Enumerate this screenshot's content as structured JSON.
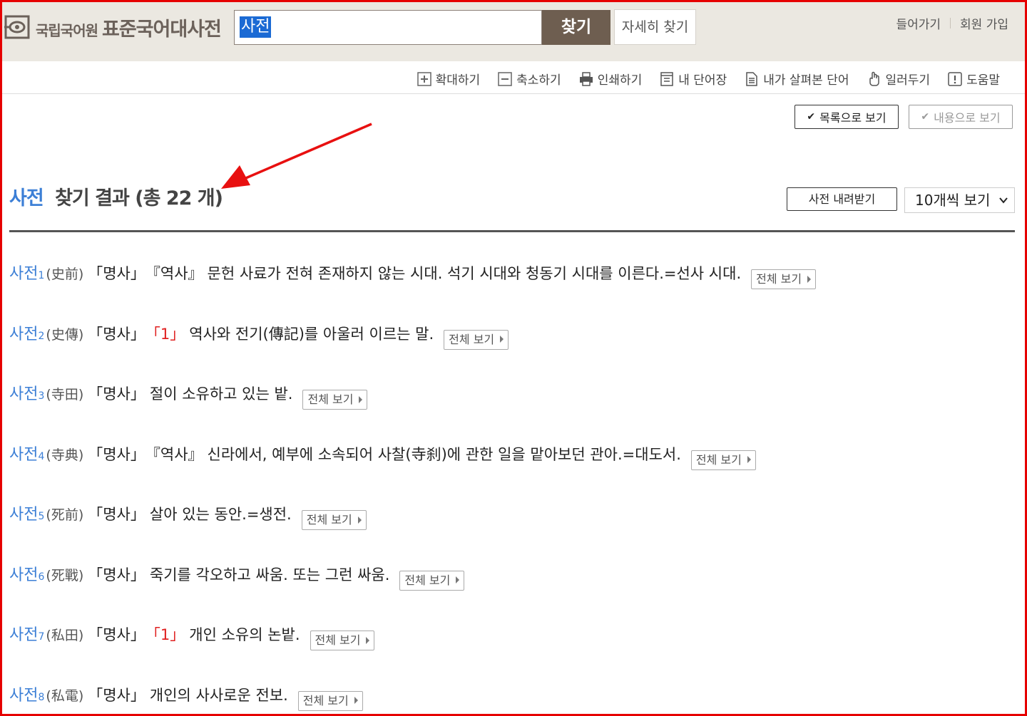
{
  "header": {
    "logo_org": "국립국어원",
    "logo_title": "표준국어대사전",
    "search_value": "사전",
    "search_button": "찾기",
    "detail_search_button": "자세히 찾기",
    "login_link": "들어가기",
    "signup_link": "회원 가입"
  },
  "toolbar": {
    "zoom_in": "확대하기",
    "zoom_out": "축소하기",
    "print": "인쇄하기",
    "my_words": "내 단어장",
    "viewed_words": "내가 살펴본 단어",
    "notice": "일러두기",
    "help": "도움말"
  },
  "view": {
    "list_view": "목록으로 보기",
    "content_view": "내용으로 보기"
  },
  "results": {
    "query": "사전",
    "label": "찾기 결과 (총 22 개)",
    "download_button": "사전 내려받기",
    "per_page": "10개씩 보기"
  },
  "entries": [
    {
      "word": "사전",
      "num": "1",
      "hanja": "(史前)",
      "pos": "「명사」",
      "field": "『역사』",
      "sense": "",
      "def": "문헌 사료가 전혀 존재하지 않는 시대. 석기 시대와 청동기 시대를 이른다.=선사 시대.",
      "more": "전체 보기"
    },
    {
      "word": "사전",
      "num": "2",
      "hanja": "(史傳)",
      "pos": "「명사」",
      "field": "",
      "sense": "「1」",
      "def": "역사와 전기(傳記)를 아울러 이르는 말.",
      "more": "전체 보기"
    },
    {
      "word": "사전",
      "num": "3",
      "hanja": "(寺田)",
      "pos": "「명사」",
      "field": "",
      "sense": "",
      "def": "절이 소유하고 있는 밭.",
      "more": "전체 보기"
    },
    {
      "word": "사전",
      "num": "4",
      "hanja": "(寺典)",
      "pos": "「명사」",
      "field": "『역사』",
      "sense": "",
      "def": "신라에서, 예부에 소속되어 사찰(寺刹)에 관한 일을 맡아보던 관아.=대도서.",
      "more": "전체 보기"
    },
    {
      "word": "사전",
      "num": "5",
      "hanja": "(死前)",
      "pos": "「명사」",
      "field": "",
      "sense": "",
      "def": "살아 있는 동안.=생전.",
      "more": "전체 보기"
    },
    {
      "word": "사전",
      "num": "6",
      "hanja": "(死戰)",
      "pos": "「명사」",
      "field": "",
      "sense": "",
      "def": "죽기를 각오하고 싸움. 또는 그런 싸움.",
      "more": "전체 보기"
    },
    {
      "word": "사전",
      "num": "7",
      "hanja": "(私田)",
      "pos": "「명사」",
      "field": "",
      "sense": "「1」",
      "def": "개인 소유의 논밭.",
      "more": "전체 보기"
    },
    {
      "word": "사전",
      "num": "8",
      "hanja": "(私電)",
      "pos": "「명사」",
      "field": "",
      "sense": "",
      "def": "개인의 사사로운 전보.",
      "more": "전체 보기"
    }
  ],
  "colors": {
    "header_bg": "#ebe8e1",
    "search_button_bg": "#6e5e50",
    "link_blue": "#3c7fd6",
    "sense_red": "#e02020",
    "frame_red": "#e60000"
  }
}
